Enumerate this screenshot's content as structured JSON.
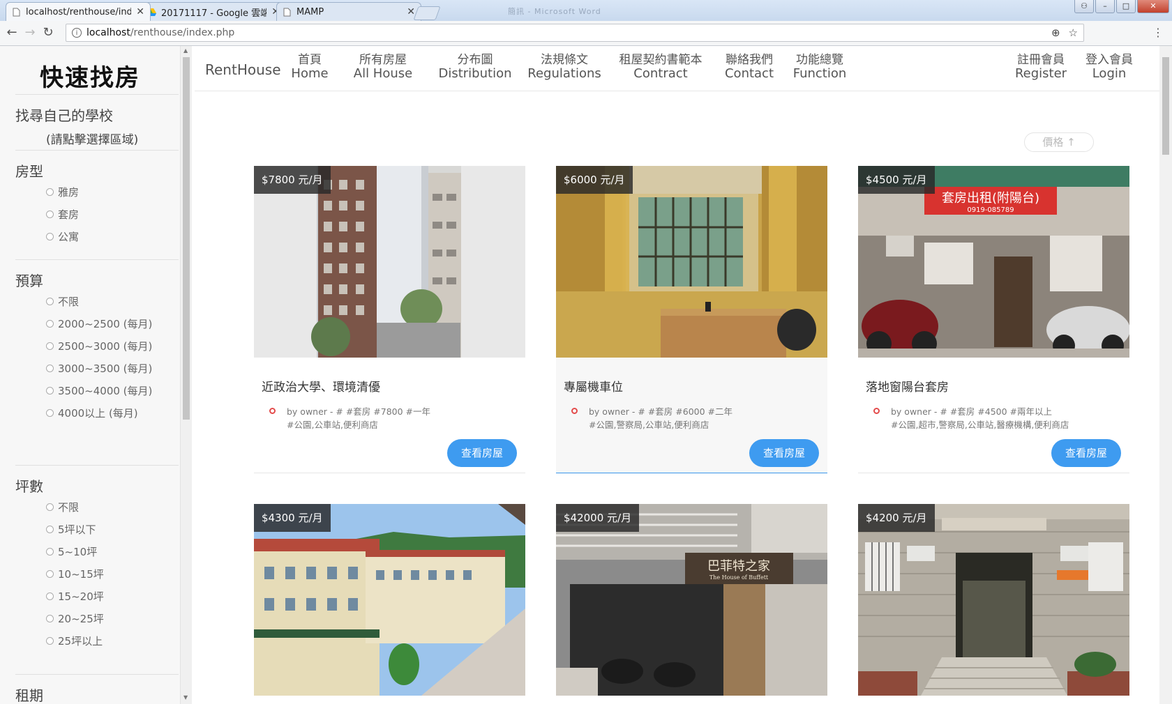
{
  "browser": {
    "tabs": [
      {
        "title": "localhost/renthouse/ind",
        "icon": "page-icon"
      },
      {
        "title": "20171117 - Google 雲端",
        "icon": "drive-icon"
      },
      {
        "title": "MAMP",
        "icon": "page-icon"
      }
    ],
    "window_title": "簡訊 - Microsoft Word",
    "url_host": "localhost",
    "url_path": "/renthouse/index.php"
  },
  "sidebar": {
    "brand": "快速找房",
    "school": {
      "heading": "找尋自己的學校",
      "hint": "(請點擊選擇區域)"
    },
    "room_type": {
      "heading": "房型",
      "options": [
        "雅房",
        "套房",
        "公寓"
      ]
    },
    "budget": {
      "heading": "預算",
      "options": [
        "不限",
        "2000~2500 (每月)",
        "2500~3000 (每月)",
        "3000~3500 (每月)",
        "3500~4000 (每月)",
        "4000以上 (每月)"
      ]
    },
    "size": {
      "heading": "坪數",
      "options": [
        "不限",
        "5坪以下",
        "5~10坪",
        "10~15坪",
        "15~20坪",
        "20~25坪",
        "25坪以上"
      ]
    },
    "lease": {
      "heading": "租期"
    }
  },
  "nav": {
    "logo": "RentHouse",
    "items": [
      {
        "cn": "首頁",
        "en": "Home"
      },
      {
        "cn": "所有房屋",
        "en": "All House"
      },
      {
        "cn": "分布圖",
        "en": "Distribution"
      },
      {
        "cn": "法規條文",
        "en": "Regulations"
      },
      {
        "cn": "租屋契約書範本",
        "en": "Contract"
      },
      {
        "cn": "聯絡我們",
        "en": "Contact"
      },
      {
        "cn": "功能總覽",
        "en": "Function"
      }
    ],
    "register": {
      "cn": "註冊會員",
      "en": "Register"
    },
    "login": {
      "cn": "登入會員",
      "en": "Login"
    }
  },
  "sort_label": "價格 ↑",
  "view_button": "查看房屋",
  "listings": [
    {
      "price": "$7800 元/月",
      "title": "近政治大學、環境清優",
      "meta1": "by owner - # #套房 #7800 #一年",
      "meta2": "#公園,公車站,便利商店"
    },
    {
      "price": "$6000 元/月",
      "title": "專屬機車位",
      "meta1": "by owner - # #套房 #6000 #二年",
      "meta2": "#公園,警察局,公車站,便利商店"
    },
    {
      "price": "$4500 元/月",
      "title": "落地窗陽台套房",
      "meta1": "by owner - # #套房 #4500 #兩年以上",
      "meta2": "#公園,超市,警察局,公車站,醫療機構,便利商店"
    },
    {
      "price": "$4300 元/月"
    },
    {
      "price": "$42000 元/月"
    },
    {
      "price": "$4200 元/月"
    }
  ],
  "photo_signs": {
    "sign1": "套房出租(附陽台)",
    "sign1b": "0919-085789",
    "sign2": "巴菲特之家",
    "sign2b": "The House of Buffett"
  }
}
